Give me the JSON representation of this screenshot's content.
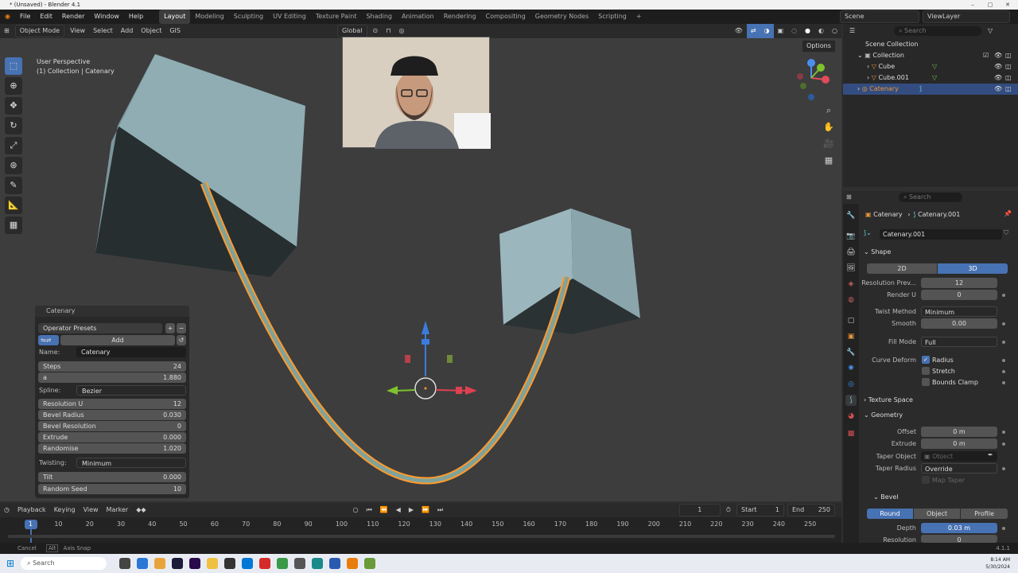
{
  "window": {
    "title": "* (Unsaved) - Blender 4.1"
  },
  "menu": {
    "items": [
      "File",
      "Edit",
      "Render",
      "Window",
      "Help"
    ],
    "workspaces": [
      "Layout",
      "Modeling",
      "Sculpting",
      "UV Editing",
      "Texture Paint",
      "Shading",
      "Animation",
      "Rendering",
      "Compositing",
      "Geometry Nodes",
      "Scripting"
    ],
    "active_workspace": "Layout",
    "scene": "Scene",
    "viewlayer": "ViewLayer"
  },
  "viewport_header": {
    "mode": "Object Mode",
    "items": [
      "View",
      "Select",
      "Add",
      "Object",
      "GIS"
    ],
    "orientation": "Global",
    "options": "Options"
  },
  "viewport": {
    "perspective": "User Perspective",
    "collection_info": "(1) Collection | Catenary"
  },
  "operator_panel": {
    "title": "Catenary",
    "presets": "Operator Presets",
    "add": "Add",
    "name_label": "Name:",
    "name_value": "Catenary",
    "steps_label": "Steps",
    "steps_value": "24",
    "a_label": "a",
    "a_value": "1.880",
    "spline_label": "Spline:",
    "spline_value": "Bezier",
    "res_u_label": "Resolution U",
    "res_u_value": "12",
    "bevel_radius_label": "Bevel Radius",
    "bevel_radius_value": "0.030",
    "bevel_res_label": "Bevel Resolution",
    "bevel_res_value": "0",
    "extrude_label": "Extrude",
    "extrude_value": "0.000",
    "randomise_label": "Randomise",
    "randomise_value": "1.020",
    "twisting_label": "Twisting:",
    "twisting_value": "Minimum",
    "tilt_label": "Tilt",
    "tilt_value": "0.000",
    "seed_label": "Random Seed",
    "seed_value": "10"
  },
  "timeline": {
    "items": [
      "Playback",
      "Keying",
      "View",
      "Marker"
    ],
    "current_frame": "1",
    "start_label": "Start",
    "start": "1",
    "end_label": "End",
    "end": "250",
    "ticks": [
      "1",
      "10",
      "20",
      "30",
      "40",
      "50",
      "60",
      "70",
      "80",
      "90",
      "100",
      "110",
      "120",
      "130",
      "140",
      "150",
      "160",
      "170",
      "180",
      "190",
      "200",
      "210",
      "220",
      "230",
      "240",
      "250"
    ]
  },
  "status": {
    "cancel": "Cancel",
    "alt": "Alt",
    "axis_snap": "Axis Snap",
    "version": "4.1.1"
  },
  "taskbar": {
    "search": "Search",
    "time": "8:14 AM",
    "date": "5/30/2024"
  },
  "outliner": {
    "search_placeholder": "Search",
    "scene_collection": "Scene Collection",
    "collection": "Collection",
    "objects": [
      "Cube",
      "Cube.001",
      "Catenary"
    ]
  },
  "properties": {
    "search_placeholder": "Search",
    "object": "Catenary",
    "data": "Catenary.001",
    "data_field": "Catenary.001",
    "shape_label": "Shape",
    "btn_2d": "2D",
    "btn_3d": "3D",
    "res_preview_label": "Resolution Prev...",
    "res_preview_value": "12",
    "render_u_label": "Render U",
    "render_u_value": "0",
    "twist_label": "Twist Method",
    "twist_value": "Minimum",
    "smooth_label": "Smooth",
    "smooth_value": "0.00",
    "fill_label": "Fill Mode",
    "fill_value": "Full",
    "curve_deform_label": "Curve Deform",
    "radius_label": "Radius",
    "stretch_label": "Stretch",
    "bounds_label": "Bounds Clamp",
    "texture_space": "Texture Space",
    "geometry": "Geometry",
    "offset_label": "Offset",
    "offset_value": "0 m",
    "extrude_label": "Extrude",
    "extrude_value": "0 m",
    "taper_obj_label": "Taper Object",
    "taper_obj_placeholder": "Object",
    "taper_radius_label": "Taper Radius",
    "taper_radius_value": "Override",
    "map_taper": "Map Taper",
    "bevel": "Bevel",
    "round": "Round",
    "object_btn": "Object",
    "profile": "Profile",
    "depth_label": "Depth",
    "depth_value": "0.03 m",
    "resolution_label": "Resolution",
    "resolution_value": "0"
  },
  "colors": {
    "accent": "#4772b3",
    "selection": "#ff9a2e",
    "cube": "#8fadb3"
  }
}
